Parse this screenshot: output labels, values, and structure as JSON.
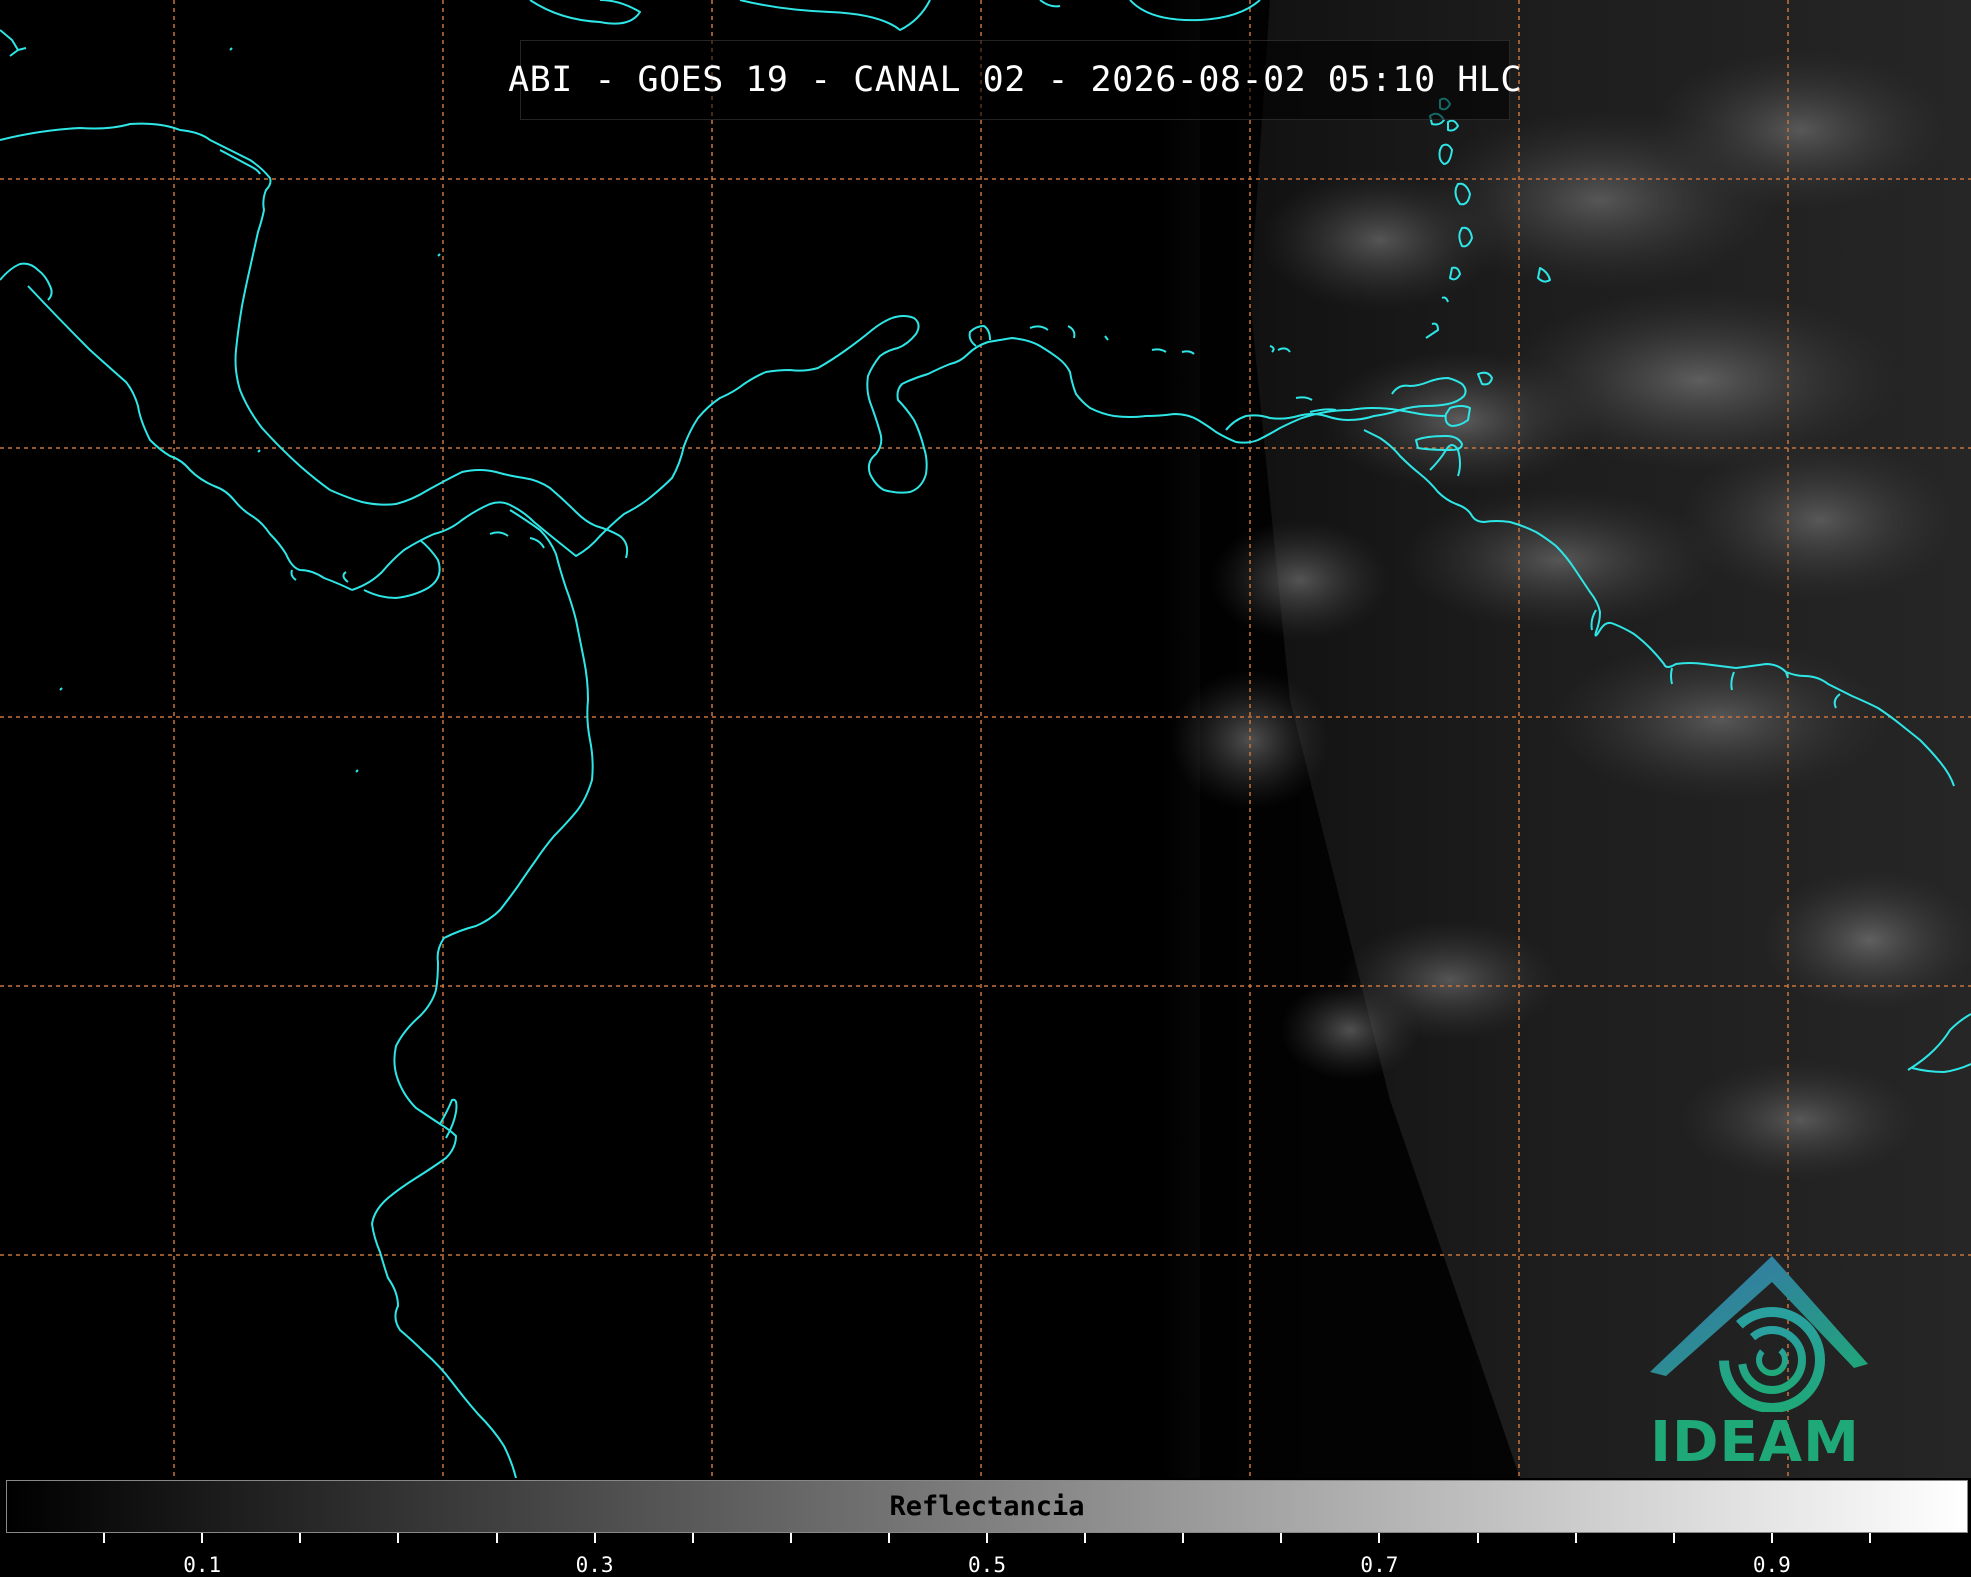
{
  "title": "ABI - GOES 19 - CANAL 02 - 2026-08-02 05:10 HLC",
  "colors": {
    "coastline": "#2ee6e6",
    "gridline": "#c8743a",
    "background": "#000000"
  },
  "logo": {
    "text": "IDEAM",
    "icon": "ideam-swirl-logo-icon"
  },
  "colorbar": {
    "label": "Reflectancia",
    "range": [
      0,
      1
    ],
    "colormap": "black-to-white",
    "ticks": [
      "0.1",
      "0.3",
      "0.5",
      "0.7",
      "0.9"
    ],
    "tick_values": [
      0.1,
      0.3,
      0.5,
      0.7,
      0.9
    ],
    "minor_step": 0.05
  }
}
